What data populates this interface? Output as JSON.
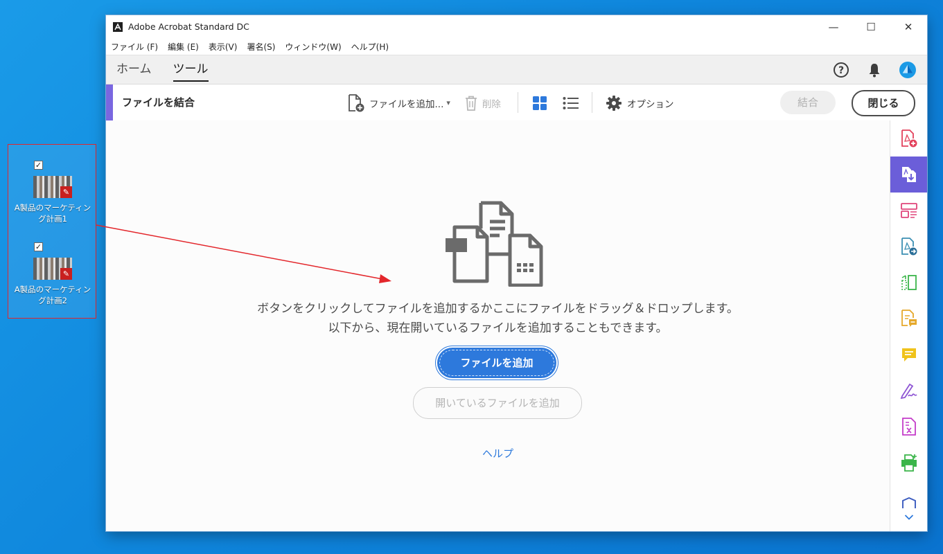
{
  "desktop": {
    "files": [
      {
        "label_line1": "A製品のマーケティン",
        "label_line2": "グ計画1",
        "checked": "✓"
      },
      {
        "label_line1": "A製品のマーケティン",
        "label_line2": "グ計画2",
        "checked": "✓"
      }
    ]
  },
  "window": {
    "title": "Adobe Acrobat Standard DC",
    "controls": {
      "minimize": "—",
      "maximize": "☐",
      "close": "✕"
    }
  },
  "menubar": {
    "items": [
      "ファイル (F)",
      "編集 (E)",
      "表示(V)",
      "署名(S)",
      "ウィンドウ(W)",
      "ヘルプ(H)"
    ]
  },
  "tabs": {
    "home": "ホーム",
    "tools": "ツール",
    "active": "ツール"
  },
  "toolbar": {
    "title": "ファイルを結合",
    "add_files": "ファイルを追加...",
    "add_files_arrow": "▾",
    "delete": "削除",
    "options": "オプション",
    "combine": "結合",
    "close": "閉じる"
  },
  "content": {
    "message_line1": "ボタンをクリックしてファイルを追加するかここにファイルをドラッグ＆ドロップします。",
    "message_line2": "以下から、現在開いているファイルを追加することもできます。",
    "add_files_button": "ファイルを追加",
    "add_open_files_button": "開いているファイルを追加",
    "help_link": "ヘルプ"
  },
  "colors": {
    "accent": "#7a67e0",
    "primary_button": "#2d79dc",
    "desktop_bg": "#0f86dc",
    "arrow": "#e3262b"
  },
  "right_rail": {
    "icons": [
      "create-pdf-icon",
      "combine-files-icon",
      "organize-pages-icon",
      "export-pdf-icon",
      "edit-pdf-icon",
      "send-for-comments-icon",
      "comment-icon",
      "fill-sign-icon",
      "compress-pdf-icon",
      "print-production-icon",
      "protect-icon"
    ],
    "scroll_down": "⌄"
  }
}
